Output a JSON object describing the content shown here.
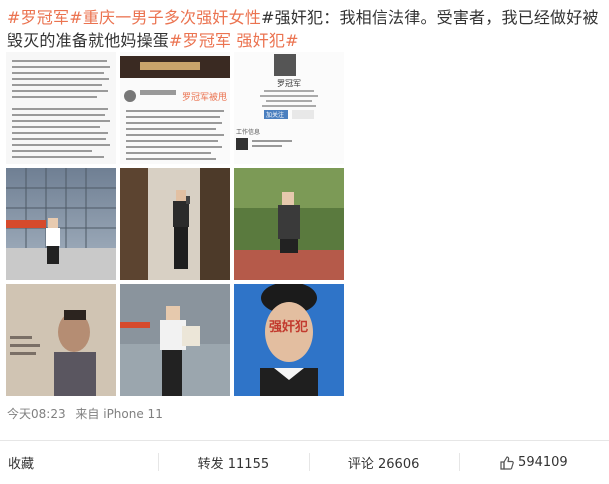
{
  "post": {
    "tag1": "#罗冠军",
    "tag2": "#重庆一男子多次强奸女性",
    "text1": "#强奸犯：我相信法律。受害者，我已经做好被毁灭的准备就他妈操蛋",
    "tag3": "#罗冠军 强奸犯#"
  },
  "images": {
    "screenshot_title": "罗冠军被甩",
    "profile_name": "罗冠军",
    "follow_label": "加关注",
    "section_label": "工作信息",
    "cert_text": "强奸犯"
  },
  "meta": {
    "time": "今天08:23",
    "source": "来自 iPhone 11"
  },
  "actions": {
    "favorite": "收藏",
    "repost": "转发 11155",
    "comment": "评论 26606",
    "like": "594109"
  },
  "colors": {
    "tag": "#eb7350",
    "meta": "#808080",
    "divider": "#e6e6e6",
    "id_photo_bg": "#2f74c8"
  }
}
